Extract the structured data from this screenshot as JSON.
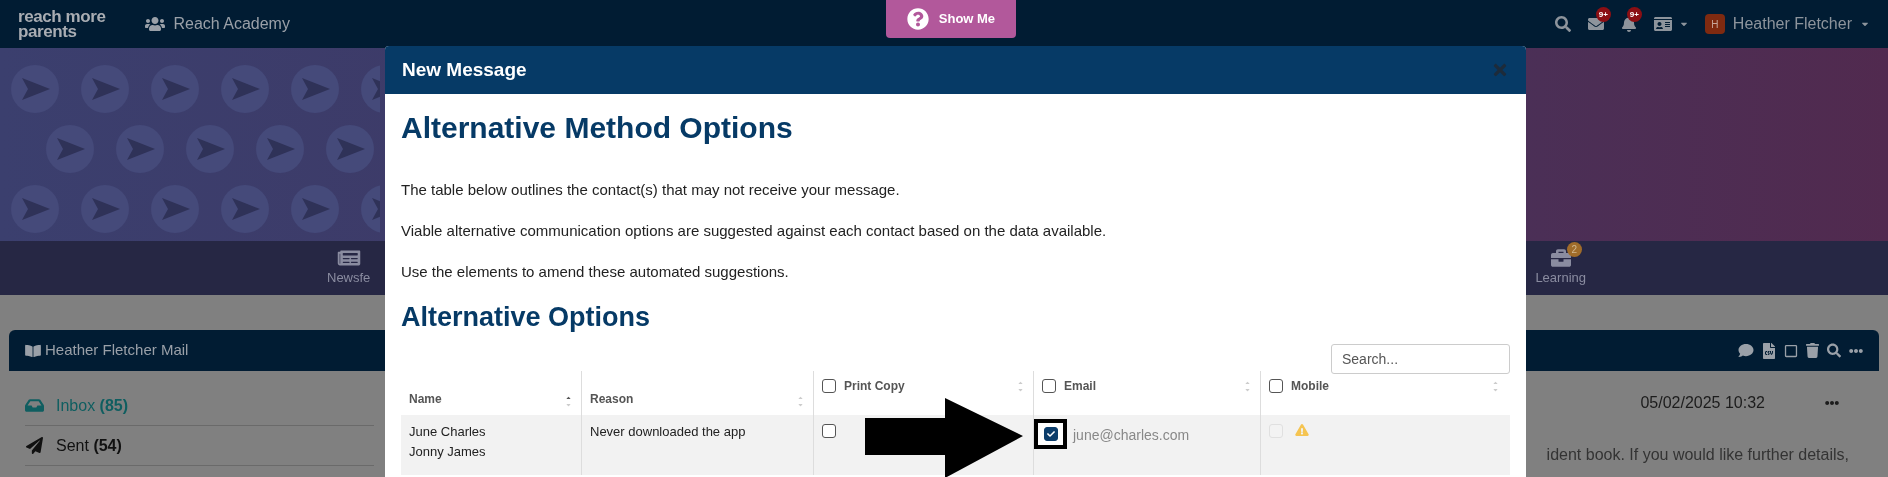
{
  "top_bar": {
    "logo": [
      "reach more",
      "parents"
    ],
    "school": "Reach Academy",
    "help_button": "Show Me",
    "mail_badge": "9+",
    "notification_badge": "9+",
    "user": {
      "initial": "H",
      "name": "Heather Fletcher"
    }
  },
  "background": {
    "nav_items": [
      {
        "label": "Newsfe",
        "kind": "news"
      },
      {
        "label": "Learning",
        "kind": "learning",
        "badge": "2"
      }
    ],
    "mail_panel": {
      "title": "Heather Fletcher Mail",
      "folders": [
        {
          "label": "Inbox",
          "count": "(85)",
          "kind": "inbox",
          "selected": true
        },
        {
          "label": "Sent",
          "count": "(54)",
          "kind": "sent",
          "selected": false
        }
      ],
      "message": {
        "date": "05/02/2025 10:32",
        "snippet": "ident book. If you would like further details,"
      }
    }
  },
  "modal": {
    "title": "New Message",
    "heading": "Alternative Method Options",
    "paragraphs": [
      "The table below outlines the contact(s) that may not receive your message.",
      "Viable alternative communication options are suggested against each contact based on the data available.",
      "Use the elements to amend these automated suggestions."
    ],
    "subheading": "Alternative Options",
    "search": {
      "placeholder": "Search..."
    },
    "table": {
      "columns": [
        {
          "label": "Name",
          "sorted": true,
          "kind": "text"
        },
        {
          "label": "Reason",
          "sorted": false,
          "kind": "text"
        },
        {
          "label": "Print Copy",
          "sorted": false,
          "kind": "checkbox",
          "checked": false
        },
        {
          "label": "Email",
          "sorted": false,
          "kind": "checkbox",
          "checked": false
        },
        {
          "label": "Mobile",
          "sorted": false,
          "kind": "checkbox",
          "checked": false
        }
      ],
      "rows": [
        {
          "names": [
            "June Charles",
            "Jonny James"
          ],
          "reason": "Never downloaded the app",
          "print_copy": {
            "checked": false
          },
          "email": {
            "checked": true,
            "address": "june@charles.com"
          },
          "mobile": {
            "checked": false,
            "disabled": true,
            "warning": true
          }
        }
      ]
    }
  }
}
